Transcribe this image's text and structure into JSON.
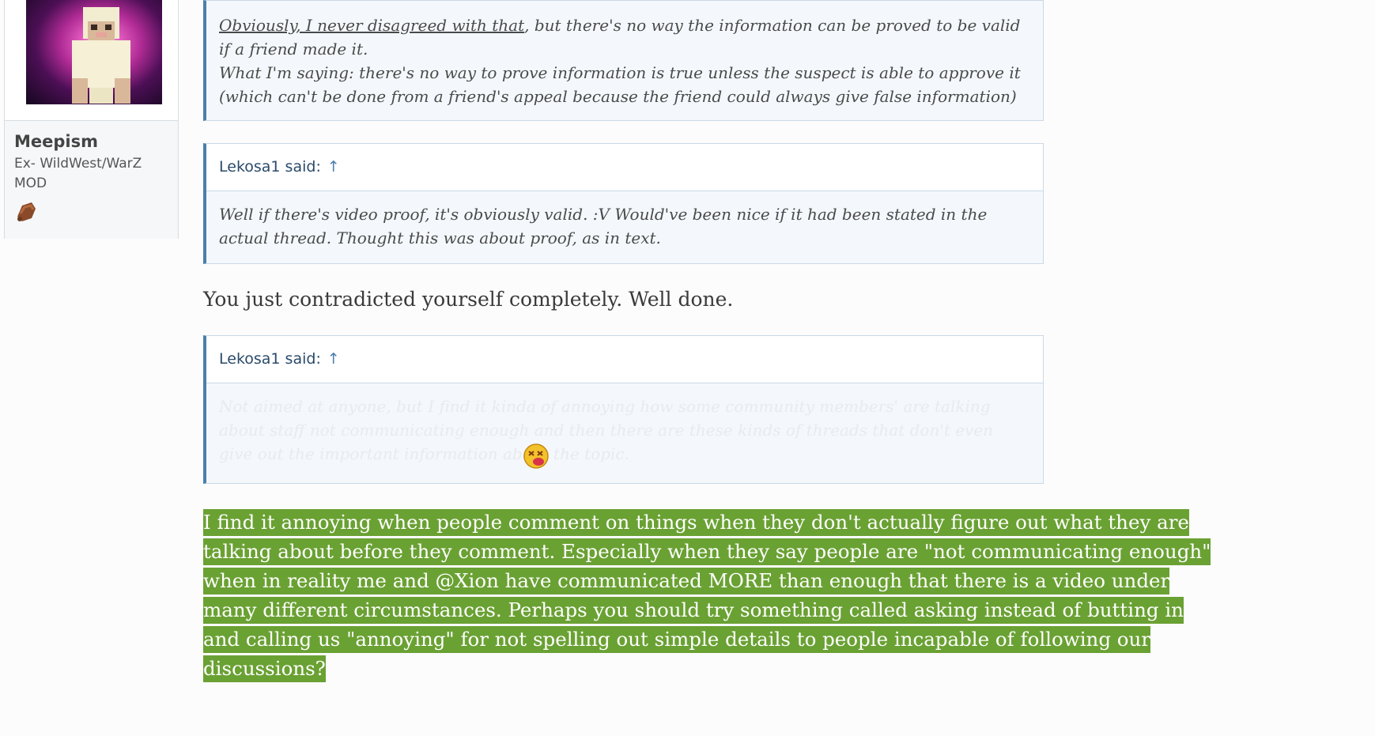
{
  "user": {
    "name": "Meepism",
    "title": "Ex- WildWest/WarZ MOD",
    "avatar_icon": "sheep-avatar-icon",
    "trophy_icon": "meat-trophy-icon"
  },
  "quotes": [
    {
      "underlined": "Obviously, I never disagreed with that",
      "body": ", but there's no way the information can be proved to be valid if a friend made it.",
      "body2": "What I'm saying: there's no way to prove information is true unless the suspect is able to approve it (which can't be done from a friend's appeal because the friend could always give false information)"
    },
    {
      "author": "Lekosa1 said:",
      "arrow": "↑",
      "body": "Well if there's video proof, it's obviously valid. :V Would've been nice if it had been stated in the actual thread. Thought this was about proof, as in text."
    },
    {
      "author": "Lekosa1 said:",
      "arrow": "↑",
      "body": "Not aimed at anyone, but I find it kinda of annoying how some community members' are talking about staff not communicating enough and then there are these kinds of threads that don't even give out the important information about the topic."
    }
  ],
  "reply_1": "You just contradicted yourself completely. Well done.",
  "reply_2": "I find it annoying when people comment on things when they don't actually figure out what they are talking about before they comment. Especially when they say people are \"not communicating enough\" when in reality me and @Xion have communicated MORE than enough that there is a video under many different circumstances. Perhaps you should try something called asking instead of butting in and calling us \"annoying\" for not spelling out simple details to people incapable of following our discussions?",
  "colors": {
    "highlight": "#6aa133",
    "quote_border": "#4a7fab",
    "quote_bg": "#f4f8fc"
  }
}
